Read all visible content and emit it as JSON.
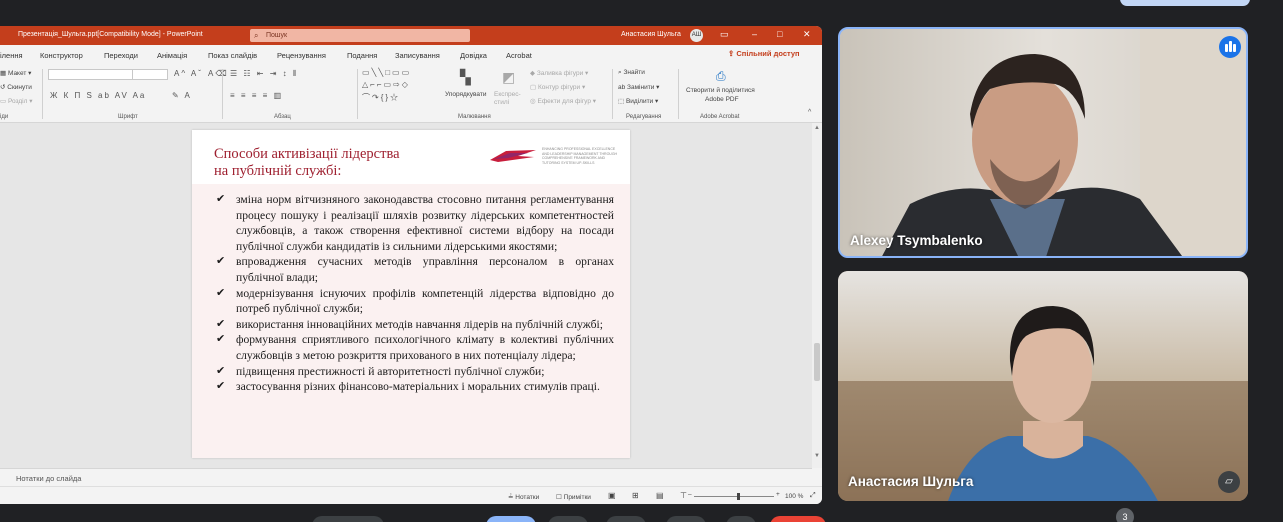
{
  "ppt": {
    "file_title": "Презентація_Шульга.ppt[Compatibility Mode] - PowerPoint",
    "search_placeholder": "Пошук",
    "user_name": "Анастасия Шульга",
    "user_initials": "АШ",
    "share_label": "Спільний доступ",
    "menu": [
      "ілення",
      "Конструктор",
      "Переходи",
      "Анімація",
      "Показ слайдів",
      "Рецензування",
      "Подання",
      "Записування",
      "Довідка",
      "Acrobat"
    ],
    "ribbon": {
      "layout": "Макет",
      "reset": "Скинути",
      "section": "Розділ",
      "groups": {
        "slides": "іди",
        "font": "Шрифт",
        "paragraph": "Абзац",
        "drawing": "Малювання",
        "editing": "Редагування",
        "acrobat": "Adobe Acrobat"
      },
      "arrange": "Упорядкувати",
      "quick_styles": "Експрес-стилі",
      "shape_fill": "Заливка фігури",
      "shape_outline": "Контур фігури",
      "shape_effects": "Ефекти для фігур",
      "find": "Знайти",
      "replace": "Замінити",
      "select": "Виділити",
      "create_pdf_line1": "Створити й поділитися",
      "create_pdf_line2": "Adobe PDF"
    },
    "notes_label": "Нотатки до слайда",
    "status": {
      "notes": "Нотатки",
      "comments": "Примітки",
      "zoom": "100 %"
    }
  },
  "slide": {
    "title_line1": "Способи активізації лідерства",
    "title_line2": "на публічній службі:",
    "logo_caption": "ENHANCING PROFESSIONAL EXCELLENCE AND LEADERSHIP MANAGEMENT THROUGH COMPREHENSIVE FRAMEWORK AND TUTORING SYSTEM UP-SKILLS",
    "bullets": [
      "зміна норм вітчизняного законодавства стосовно питання регламентування процесу пошуку і реалізації шляхів розвитку лідерських компетентностей службовців, а також створення ефективної системи відбору на посади публічної служби кандидатів із сильними лідерськими якостями;",
      "впровадження сучасних методів управління персоналом в органах публічної влади;",
      "модернізування існуючих профілів компетенцій лідерства відповідно до потреб публічної служби;",
      "використання інноваційних методів навчання лідерів на публічній службі;",
      "формування сприятливого психологічного клімату в колективі публічних службовців з метою розкриття прихованого в них потенціалу лідера;",
      "підвищення престижності й авторитетності публічної служби;",
      "застосування різних фінансово-матеріальних і моральних стимулів праці."
    ]
  },
  "participants": [
    {
      "name": "Alexey Tsymbalenko",
      "speaking": true
    },
    {
      "name": "Анастасия Шульга",
      "speaking": false
    }
  ],
  "meet": {
    "participant_count": "3",
    "accent": "#8ab4f8"
  }
}
